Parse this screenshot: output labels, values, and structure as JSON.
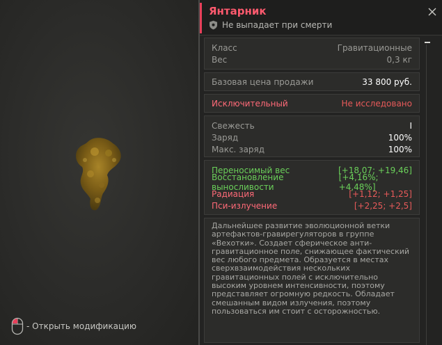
{
  "viewer": {
    "hint_text": "- Открыть модификацию",
    "hint_icon": "mouse-icon",
    "artifact_color": "#8a6a1e"
  },
  "header": {
    "title": "Янтарник",
    "subtitle": "Не выпадает при смерти",
    "subtitle_icon": "shield-icon",
    "close_icon": "close-icon",
    "accent_color": "#e8405a"
  },
  "stats": {
    "class_label": "Класс",
    "class_value": "Гравитационные",
    "weight_label": "Вес",
    "weight_value": "0,3 кг",
    "price_label": "Базовая цена продажи",
    "price_value": "33 800 руб.",
    "rarity_label": "Исключительный",
    "rarity_value": "Не исследовано",
    "freshness_label": "Свежесть",
    "freshness_value": "I",
    "charge_label": "Заряд",
    "charge_value": "100%",
    "max_charge_label": "Макс. заряд",
    "max_charge_value": "100%"
  },
  "effects": [
    {
      "label": "Переносимый вес",
      "value": "[+18,07; +19,46]",
      "type": "positive"
    },
    {
      "label": "Восстановление выносливости",
      "value": "[+4,16%; +4,48%]",
      "type": "positive"
    },
    {
      "label": "Радиация",
      "value": "[+1,12; +1,25]",
      "type": "negative"
    },
    {
      "label": "Пси-излучение",
      "value": "[+2,25; +2,5]",
      "type": "negative"
    }
  ],
  "description": "Дальнейшее развитие эволюционной ветки артефактов-гравирегуляторов в группе «Вехотки». Создает сферическое анти-гравитационное поле, снижающее фактический вес любого предмета. Образуется в местах сверхвзаимодействия нескольких гравитационных полей с исключительно высоким уровнем интенсивности, поэтому представляет огромную редкость. Обладает смешанным видом излучения, поэтому пользоваться им стоит с осторожностью.",
  "colors": {
    "positive": "#6bd05a",
    "negative": "#e85a5a",
    "title": "#ff5a6e"
  }
}
